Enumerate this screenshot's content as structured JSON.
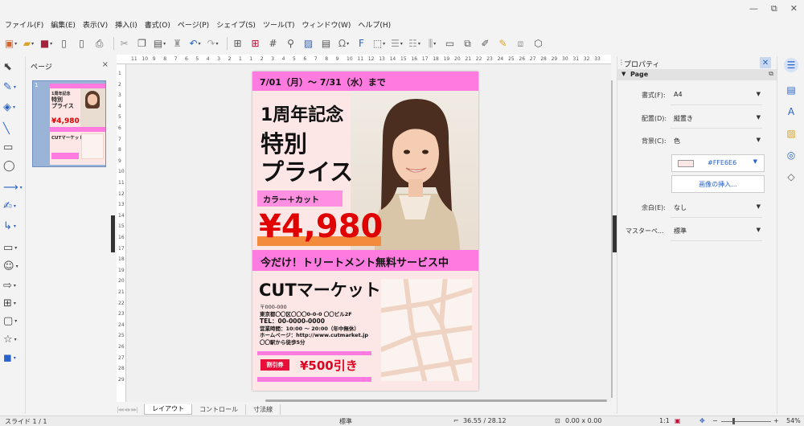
{
  "menu": [
    "ファイル(F)",
    "編集(E)",
    "表示(V)",
    "挿入(I)",
    "書式(O)",
    "ページ(P)",
    "シェイプ(S)",
    "ツール(T)",
    "ウィンドウ(W)",
    "ヘルプ(H)"
  ],
  "window_controls": {
    "minimize": "—",
    "restore": "⧉",
    "close": "✕"
  },
  "page_pane": {
    "title": "ページ",
    "close": "×",
    "slide_number": "1"
  },
  "ruler": {
    "h_ticks": [
      "11",
      "10",
      "9",
      "8",
      "7",
      "6",
      "5",
      "4",
      "3",
      "2",
      "1",
      "1",
      "2",
      "3",
      "4",
      "5",
      "6",
      "7",
      "8",
      "9",
      "10",
      "11",
      "12",
      "13",
      "14",
      "15",
      "16",
      "17",
      "18",
      "19",
      "20",
      "21",
      "22",
      "23",
      "24",
      "25",
      "26",
      "27",
      "28",
      "29",
      "30",
      "31",
      "32",
      "33"
    ],
    "v_ticks": [
      "1",
      "2",
      "3",
      "4",
      "5",
      "6",
      "7",
      "8",
      "9",
      "10",
      "11",
      "12",
      "13",
      "14",
      "15",
      "16",
      "17",
      "18",
      "19",
      "20",
      "21",
      "22",
      "23",
      "24",
      "25",
      "26",
      "27",
      "28",
      "29"
    ]
  },
  "flyer": {
    "date": "7/01（月）～ 7/31（水）まで",
    "title1": "1周年記念",
    "title2": "特別",
    "title3": "プライス",
    "service": "カラー＋カット",
    "price": "¥4,980",
    "treatment": "今だけ！トリートメント無料サービス中",
    "shop_name": "CUTマーケット",
    "postal": "〒000-000",
    "address": "東京都〇〇区〇〇〇0-0-0 〇〇ビル2F",
    "tel": "TEL：00-0000-0000",
    "hours": "営業時間：10:00 ～ 20:00（年中無休）",
    "homepage": "ホームページ：http://www.cutmarket.jp",
    "access": "〇〇駅から徒歩5分",
    "coupon_tag": "割引券",
    "coupon_text": "¥500引き"
  },
  "thumb": {
    "title1": "1周年記念",
    "title2": "特別",
    "title3": "プライス",
    "price": "¥4,980",
    "shop_name": "CUTマーケット"
  },
  "tabs": [
    "レイアウト",
    "コントロール",
    "寸法線"
  ],
  "tab_nav": "|◂◂ ◂ ▸ ▸▸|",
  "statusbar": {
    "slide": "スライド 1 / 1",
    "style": "標準",
    "position": "36.55 / 28.12",
    "size": "0.00 x 0.00",
    "scale": "1:1",
    "zoom": "54%"
  },
  "sidebar": {
    "title": "プロパティ",
    "close": "✕",
    "section": "Page",
    "format_label": "書式(F):",
    "format_value": "A4",
    "orientation_label": "配置(D):",
    "orientation_value": "縦置き",
    "background_label": "背景(C):",
    "background_value": "色",
    "color_value": "#FFE6E6",
    "insert_image": "画像の挿入...",
    "margin_label": "余白(E):",
    "margin_value": "なし",
    "master_label": "マスターペ...",
    "master_value": "標準"
  },
  "colors": {
    "accent_pink": "#ff7be0",
    "bg_pink": "#fde6e6",
    "price_red": "#e00000",
    "link_blue": "#2a62c9"
  }
}
